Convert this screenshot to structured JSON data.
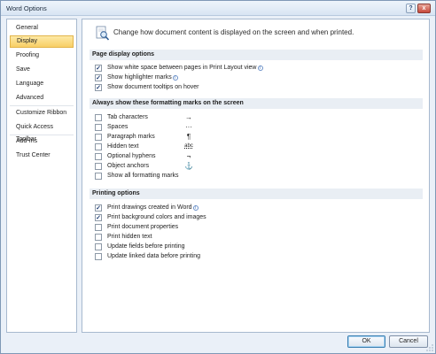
{
  "window": {
    "title": "Word Options"
  },
  "titlebar": {
    "help_label": "?",
    "close_label": "x"
  },
  "sidebar": {
    "items": [
      {
        "label": "General"
      },
      {
        "label": "Display"
      },
      {
        "label": "Proofing"
      },
      {
        "label": "Save"
      },
      {
        "label": "Language"
      },
      {
        "label": "Advanced"
      },
      {
        "label": "Customize Ribbon"
      },
      {
        "label": "Quick Access Toolbar"
      },
      {
        "label": "Add-Ins"
      },
      {
        "label": "Trust Center"
      }
    ],
    "active": "Display"
  },
  "content": {
    "intro": "Change how document content is displayed on the screen and when printed.",
    "sections": [
      {
        "title": "Page display options",
        "options": [
          {
            "label": "Show white space between pages in Print Layout view",
            "checked": true,
            "info": true
          },
          {
            "label": "Show highlighter marks",
            "checked": true,
            "info": true
          },
          {
            "label": "Show document tooltips on hover",
            "checked": true,
            "info": false
          }
        ]
      },
      {
        "title": "Always show these formatting marks on the screen",
        "options": [
          {
            "label": "Tab characters",
            "checked": false,
            "symbol": "→"
          },
          {
            "label": "Spaces",
            "checked": false,
            "symbol": "···"
          },
          {
            "label": "Paragraph marks",
            "checked": false,
            "symbol": "¶"
          },
          {
            "label": "Hidden text",
            "checked": false,
            "symbol": "abc"
          },
          {
            "label": "Optional hyphens",
            "checked": false,
            "symbol": "¬"
          },
          {
            "label": "Object anchors",
            "checked": false,
            "symbol": "⚓"
          },
          {
            "label": "Show all formatting marks",
            "checked": false
          }
        ]
      },
      {
        "title": "Printing options",
        "options": [
          {
            "label": "Print drawings created in Word",
            "checked": true,
            "info": true
          },
          {
            "label": "Print background colors and images",
            "checked": true,
            "info": false
          },
          {
            "label": "Print document properties",
            "checked": false
          },
          {
            "label": "Print hidden text",
            "checked": false
          },
          {
            "label": "Update fields before printing",
            "checked": false
          },
          {
            "label": "Update linked data before printing",
            "checked": false
          }
        ]
      }
    ]
  },
  "footer": {
    "ok_label": "OK",
    "cancel_label": "Cancel"
  },
  "icons": {
    "info": "info-icon",
    "intro": "magnifier-page-icon",
    "help": "help-icon",
    "close": "close-icon"
  },
  "colors": {
    "active_nav": "#f8cf66",
    "window_bg": "#eaf0f8",
    "checkbox_check": "#1d3c72"
  }
}
